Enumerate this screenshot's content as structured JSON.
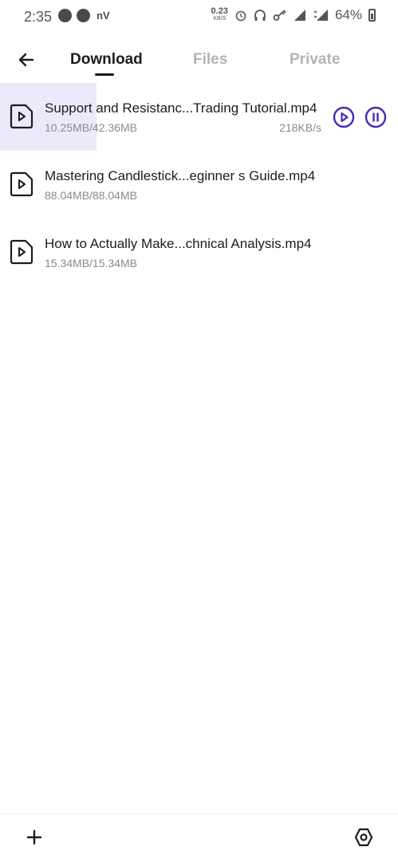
{
  "status_bar": {
    "time": "2:35",
    "carrier_label": "nV",
    "net_speed_value": "0.23",
    "net_speed_unit": "KB/S",
    "battery_percent": "64%"
  },
  "tabs": [
    {
      "label": "Download",
      "active": true
    },
    {
      "label": "Files",
      "active": false
    },
    {
      "label": "Private",
      "active": false
    }
  ],
  "downloads": [
    {
      "name": "Support and Resistanc...Trading Tutorial.mp4",
      "size": "10.25MB/42.36MB",
      "speed": "218KB/s",
      "progress": 0.242,
      "in_progress": true
    },
    {
      "name": "Mastering Candlestick...eginner s Guide.mp4",
      "size": "88.04MB/88.04MB",
      "speed": "",
      "progress": 1.0,
      "in_progress": false
    },
    {
      "name": "How to Actually Make...chnical Analysis.mp4",
      "size": "15.34MB/15.34MB",
      "speed": "",
      "progress": 1.0,
      "in_progress": false
    }
  ],
  "colors": {
    "accent": "#3d2eb5",
    "progress_bg": "#eceafa",
    "text_primary": "#1c1c1e",
    "text_secondary": "#8a8a8e",
    "tab_inactive": "#b3b3b3"
  },
  "icons": {
    "back": "arrow-left-icon",
    "file": "video-file-icon",
    "play": "play-circle-icon",
    "pause": "pause-circle-icon",
    "add": "plus-icon",
    "settings": "hexagon-settings-icon"
  }
}
